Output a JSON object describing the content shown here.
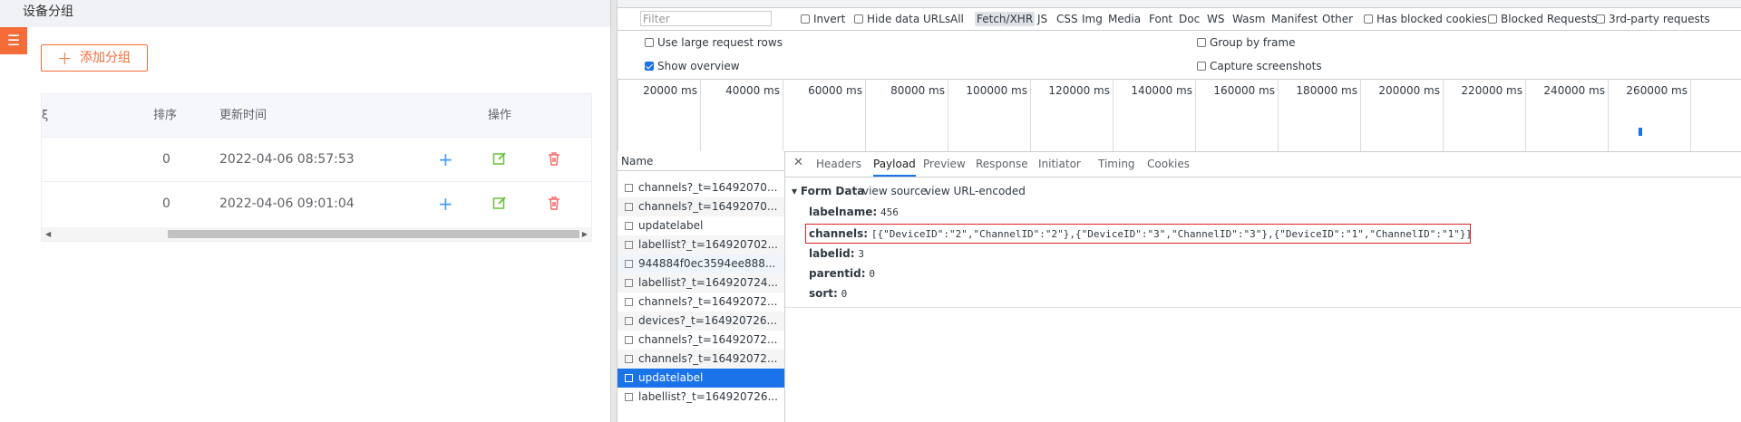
{
  "app": {
    "title": "设备分组",
    "add_label": "添加分组",
    "table": {
      "cut_header": "ξ",
      "headers": {
        "sort": "排序",
        "time": "更新时间",
        "op": "操作"
      },
      "rows": [
        {
          "sort": "0",
          "time": "2022-04-06 08:57:53"
        },
        {
          "sort": "0",
          "time": "2022-04-06 09:01:04"
        }
      ]
    }
  },
  "devtools": {
    "filter_placeholder": "Filter",
    "toolbar": {
      "invert": "Invert",
      "hide_data_urls": "Hide data URLs",
      "all": "All",
      "fetch_xhr": "Fetch/XHR",
      "js": "JS",
      "css": "CSS",
      "img": "Img",
      "media": "Media",
      "font": "Font",
      "doc": "Doc",
      "ws": "WS",
      "wasm": "Wasm",
      "manifest": "Manifest",
      "other": "Other",
      "blocked_cookies": "Has blocked cookies",
      "blocked_requests": "Blocked Requests",
      "third_party": "3rd-party requests"
    },
    "options": {
      "large_rows": "Use large request rows",
      "show_overview": "Show overview",
      "group_by_frame": "Group by frame",
      "capture_screenshots": "Capture screenshots"
    },
    "overview_ticks": [
      "20000 ms",
      "40000 ms",
      "60000 ms",
      "80000 ms",
      "100000 ms",
      "120000 ms",
      "140000 ms",
      "160000 ms",
      "180000 ms",
      "200000 ms",
      "220000 ms",
      "240000 ms",
      "260000 ms"
    ],
    "name_header": "Name",
    "requests": [
      "channels?_t=16492070...",
      "channels?_t=16492070...",
      "updatelabel",
      "labellist?_t=164920702...",
      "944884f0ec3594ee888...",
      "labellist?_t=164920724...",
      "channels?_t=16492072...",
      "devices?_t=164920726...",
      "channels?_t=16492072...",
      "channels?_t=16492072...",
      "updatelabel",
      "labellist?_t=164920726..."
    ],
    "tabs": [
      "Headers",
      "Payload",
      "Preview",
      "Response",
      "Initiator",
      "Timing",
      "Cookies"
    ],
    "payload": {
      "section": "Form Data",
      "view_source": "view source",
      "view_url": "view URL-encoded",
      "fields": [
        {
          "key": "labelname:",
          "value": "456"
        },
        {
          "key": "channels:",
          "value": "[{\"DeviceID\":\"2\",\"ChannelID\":\"2\"},{\"DeviceID\":\"3\",\"ChannelID\":\"3\"},{\"DeviceID\":\"1\",\"ChannelID\":\"1\"}]"
        },
        {
          "key": "labelid:",
          "value": "3"
        },
        {
          "key": "parentid:",
          "value": "0"
        },
        {
          "key": "sort:",
          "value": "0"
        }
      ]
    }
  }
}
